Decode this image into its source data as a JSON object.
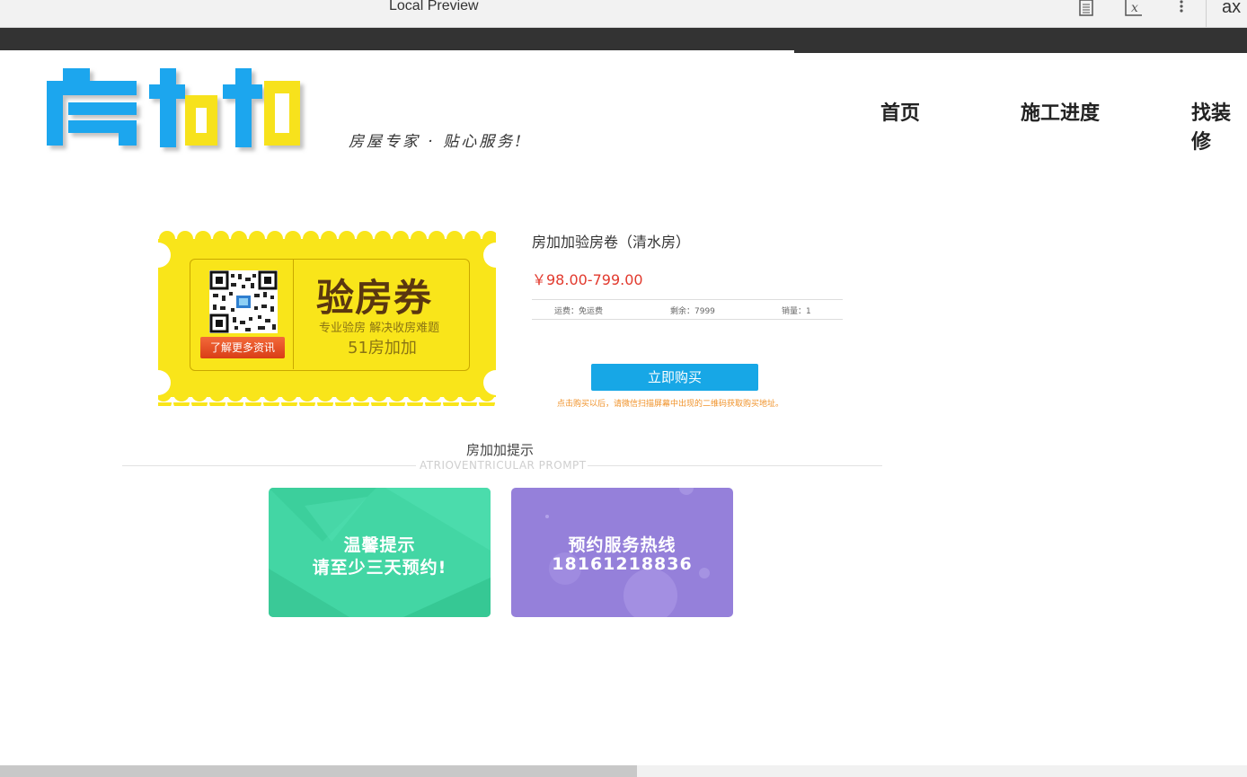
{
  "browser": {
    "title": "Local Preview",
    "icons": [
      "reader-icon",
      "formula-icon",
      "more-vert-icon"
    ],
    "ax_label": "ax"
  },
  "header": {
    "logo_text": "房加加",
    "slogan": "房屋专家 · 贴心服务!",
    "nav": [
      "首页",
      "施工进度",
      "找装修"
    ]
  },
  "coupon": {
    "title": "验房券",
    "subtitle": "专业验房 解决收房难题",
    "brand": "51房加加",
    "learn_more": "了解更多资讯"
  },
  "product": {
    "title": "房加加验房卷（清水房）",
    "price": "￥98.00-799.00",
    "shipping": "运费：免运费",
    "stock": "剩余：7999",
    "sales": "销量：1",
    "buy_label": "立即购买",
    "buy_note": "点击购买以后，请微信扫描屏幕中出现的二维码获取购买地址。"
  },
  "tips": {
    "heading": "房加加提示",
    "subheading": "ATRIOVENTRICULAR PROMPT",
    "card1_line1": "温馨提示",
    "card1_line2": "请至少三天预约!",
    "card2_line1": "预约服务热线",
    "card2_line2": "18161218836"
  },
  "colors": {
    "brand_blue": "#17a7e6",
    "brand_yellow": "#f7e21a",
    "price_red": "#e23a2e",
    "card_green": "#43d6a4",
    "card_purple": "#9580da"
  }
}
